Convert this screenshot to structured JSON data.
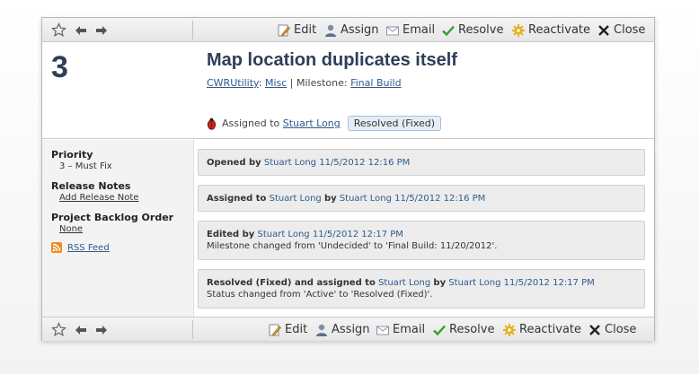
{
  "toolbar": {
    "star_icon": "star-icon",
    "back_icon": "arrow-left-icon",
    "forward_icon": "arrow-right-icon",
    "actions": [
      {
        "label": "Edit",
        "icon": "pencil-page-icon"
      },
      {
        "label": "Assign",
        "icon": "user-icon"
      },
      {
        "label": "Email",
        "icon": "envelope-icon"
      },
      {
        "label": "Resolve",
        "icon": "checkmark-icon"
      },
      {
        "label": "Reactivate",
        "icon": "gear-icon"
      },
      {
        "label": "Close",
        "icon": "close-x-icon"
      }
    ]
  },
  "case": {
    "number": "3",
    "title": "Map location duplicates itself",
    "project": "CWRUtility",
    "area": "Misc",
    "milestone_label": "Milestone:",
    "milestone": "Final Build",
    "assigned_prefix": "Assigned to",
    "assignee": "Stuart Long",
    "status": "Resolved (Fixed)",
    "bug_icon": "bug-icon"
  },
  "sidebar": {
    "priority_label": "Priority",
    "priority_value": "3 – Must Fix",
    "release_notes_label": "Release Notes",
    "release_notes_link": "Add Release Note",
    "backlog_label": "Project Backlog Order",
    "backlog_value": "None",
    "rss_label": "RSS Feed",
    "rss_icon": "rss-icon"
  },
  "events": [
    {
      "action": "Opened by",
      "user": "Stuart Long",
      "date": "11/5/2012 12:16 PM",
      "detail": ""
    },
    {
      "action": "Assigned to",
      "target": "Stuart Long",
      "by": "by",
      "user": "Stuart Long",
      "date": "11/5/2012 12:16 PM",
      "detail": ""
    },
    {
      "action": "Edited by",
      "user": "Stuart Long",
      "date": "11/5/2012 12:17 PM",
      "detail": "Milestone changed from 'Undecided' to 'Final Build: 11/20/2012'."
    },
    {
      "action": "Resolved (Fixed) and assigned to",
      "target": "Stuart Long",
      "by": "by",
      "user": "Stuart Long",
      "date": "11/5/2012 12:17 PM",
      "detail": "Status changed from 'Active' to 'Resolved (Fixed)'."
    }
  ],
  "colors": {
    "title": "#2e3e58",
    "link": "#2d5b8c",
    "event_bg": "#ececec",
    "status_bg": "#e5eef8"
  }
}
